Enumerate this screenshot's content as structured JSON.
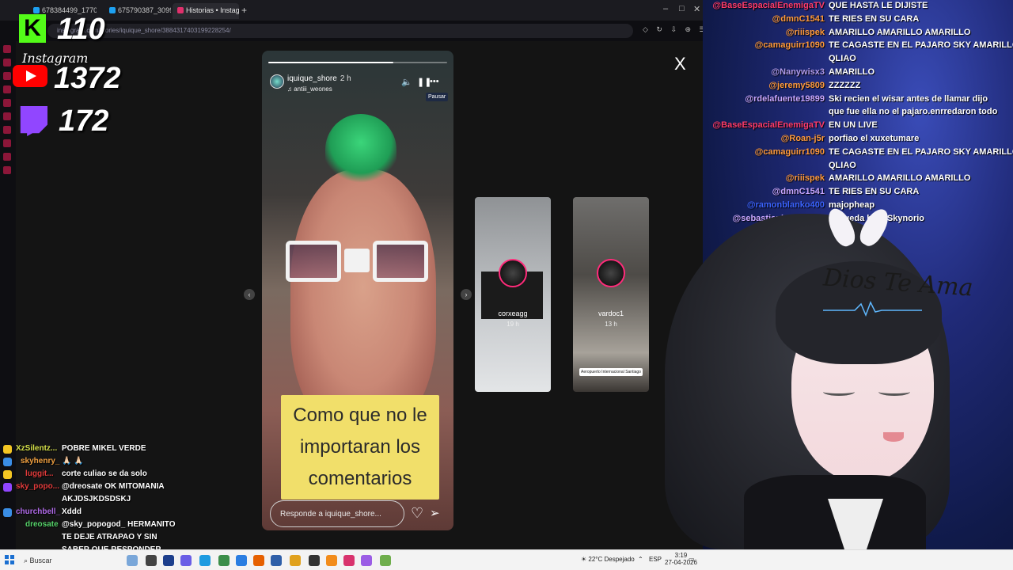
{
  "browser": {
    "tabs": [
      {
        "label": "678384499_17700552...",
        "color": "#1da1f2"
      },
      {
        "label": "675790387_30997546690...",
        "color": "#1da1f2"
      },
      {
        "label": "Historias • Instagram",
        "color": "#e1306c"
      }
    ],
    "new_tab_icon": "plus-icon",
    "address": "instagram.com/stories/iquique_shore/3884317403199228254/"
  },
  "story": {
    "username": "iquique_shore",
    "time": "2 h",
    "subtitle": "antiii_weones",
    "progress": 0.7,
    "pause_tooltip": "Pausar",
    "caption_lines": [
      "Como que no le",
      "importaran los",
      "comentarios"
    ],
    "reply_placeholder": "Responde a iquique_shore...",
    "close_label": "X"
  },
  "previews": [
    {
      "name": "corxeagg",
      "time": "19 h"
    },
    {
      "name": "vardoc1",
      "time": "13 h",
      "tag": "Aeropuerto Internacional Santiago"
    }
  ],
  "counters": {
    "kick": "110",
    "instagram_label": "Instagram",
    "youtube": "1372",
    "twitch": "172",
    "kick_logo": "K"
  },
  "left_chat": [
    {
      "name": "XzSilentz...",
      "name_color": "#d6e14a",
      "msg": "POBRE MIKEL VERDE",
      "badge": "#f3c623"
    },
    {
      "name": "skyhenry_",
      "name_color": "#f0a040",
      "msg": "🙏🏻 🙏🏻",
      "badge": "#3a8ee6"
    },
    {
      "name": "luggit...",
      "name_color": "#e23b3b",
      "msg": "corte culiao se da solo",
      "badge": "#f3c623"
    },
    {
      "name": "sky_popo...",
      "name_color": "#e23b3b",
      "msg": "@dreosate OK MITOMANIA",
      "badge": "#9146ff"
    },
    {
      "name": "",
      "name_color": "#ffffff",
      "msg": "AKJDSJKDSDSKJ",
      "badge": ""
    },
    {
      "name": "churchbell_",
      "name_color": "#b06ae8",
      "msg": "Xddd",
      "badge": "#3a8ee6"
    },
    {
      "name": "dreosate",
      "name_color": "#56d36a",
      "msg": "@sky_popogod_ HERMANITO",
      "badge": ""
    },
    {
      "name": "",
      "name_color": "#ffffff",
      "msg": "TE DEJE ATRAPAO Y SIN",
      "badge": ""
    },
    {
      "name": "",
      "name_color": "#ffffff",
      "msg": "SABER QUE RESPONDER",
      "badge": ""
    }
  ],
  "right_chat": [
    {
      "name": "@BaseEspacialEnemigaTV",
      "color": "#ff3b6b",
      "msg": "QUE HASTA LE DIJISTE"
    },
    {
      "name": "@dmnC1541",
      "color": "#ff9a3c",
      "msg": "TE RIES EN SU CARA"
    },
    {
      "name": "@riiispek",
      "color": "#ff9a3c",
      "msg": "AMARILLO AMARILLO AMARILLO"
    },
    {
      "name": "@camaguirr1090",
      "color": "#ff9a3c",
      "msg": "TE CAGASTE EN EL PAJARO SKY AMARILLO"
    },
    {
      "name": "",
      "color": "#ffffff",
      "msg": "QLIAO"
    },
    {
      "name": "@Nanywisx3",
      "color": "#b09ae8",
      "msg": "AMARILLO"
    },
    {
      "name": "@jeremy5809",
      "color": "#ff9a3c",
      "msg": "ZZZZZZ"
    },
    {
      "name": "@rdelafuente19899",
      "color": "#c9a7ff",
      "msg": "Ski recien el wisar antes de llamar dijo"
    },
    {
      "name": "",
      "color": "#ffffff",
      "msg": "que fue ella no el pajaro.enrredaron todo"
    },
    {
      "name": "@BaseEspacialEnemigaTV",
      "color": "#ff3b6b",
      "msg": "EN UN LIVE"
    },
    {
      "name": "@Roan-j5r",
      "color": "#ff9a3c",
      "msg": "porfiao el xuxetumare"
    },
    {
      "name": "@camaguirr1090",
      "color": "#ff9a3c",
      "msg": "TE CAGASTE EN EL PAJARO SKY AMARILLO"
    },
    {
      "name": "",
      "color": "#ffffff",
      "msg": "QLIAO"
    },
    {
      "name": "@riiispek",
      "color": "#ff9a3c",
      "msg": "AMARILLO AMARILLO AMARILLO"
    },
    {
      "name": "@dmnC1541",
      "color": "#c9a7ff",
      "msg": "TE RIES EN SU CARA"
    },
    {
      "name": "@ramonblanko400",
      "color": "#3b63ff",
      "msg": "majopheap"
    },
    {
      "name": "@sebastianbaeza2267",
      "color": "#c9a7ff",
      "msg": "te queda bien Skynorio"
    }
  ],
  "vtuber": {
    "overlay_text": "Dios Te Ama"
  },
  "taskbar": {
    "search_placeholder": "Buscar",
    "weather": "22°C  Despejado",
    "lang": "ESP",
    "time": "3:19",
    "date": "27-04-2026"
  }
}
